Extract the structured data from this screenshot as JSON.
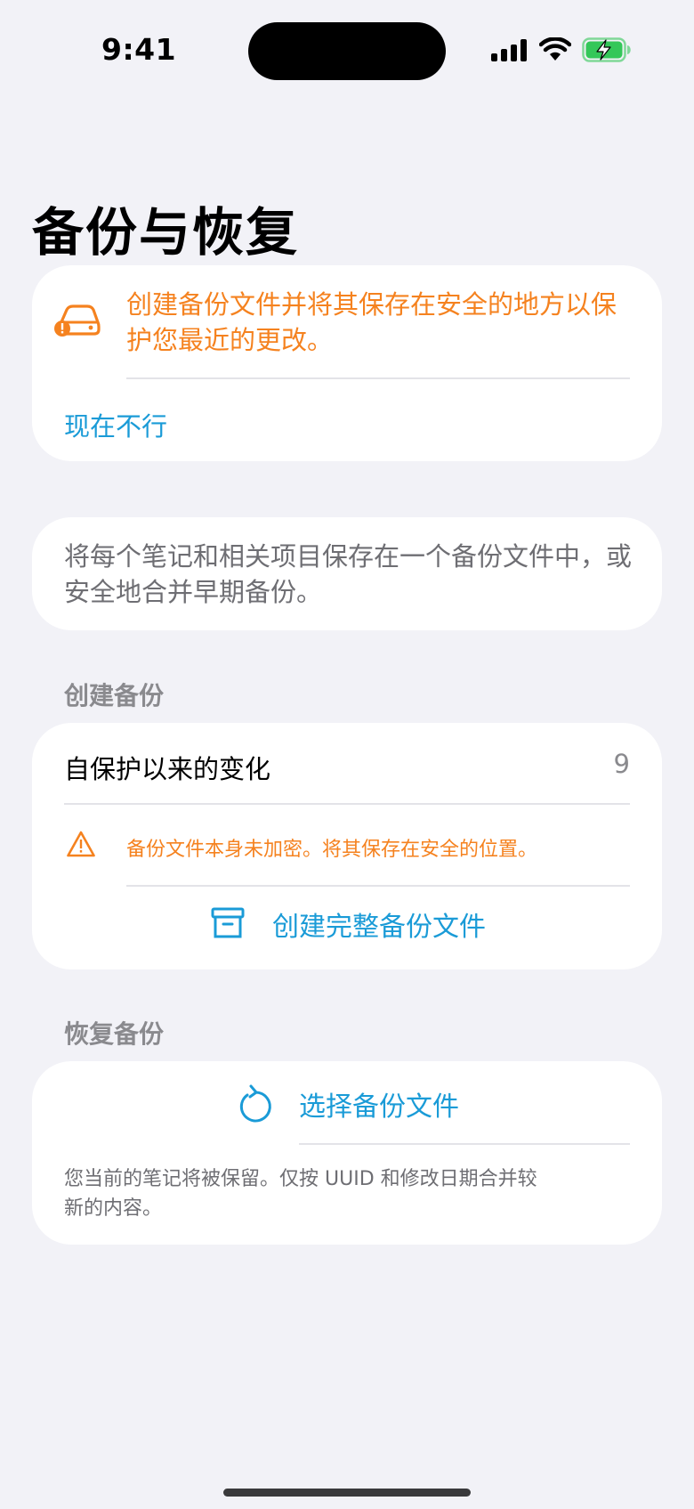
{
  "status_bar": {
    "time": "9:41",
    "icons": [
      "cellular-signal-icon",
      "wifi-icon",
      "battery-charging-icon"
    ],
    "battery_color": "#34C759"
  },
  "page": {
    "title": "备份与恢复"
  },
  "alert_card": {
    "icon": "drive-warning-icon",
    "message": "创建备份文件并将其保存在安全的地方以保护您最近的更改。",
    "dismiss_label": "现在不行"
  },
  "intro_card": {
    "text": "将每个笔记和相关项目保存在一个备份文件中，或安全地合并早期备份。"
  },
  "create_section": {
    "header": "创建备份",
    "changes_label": "自保护以来的变化",
    "changes_count": "9",
    "warning_icon": "warning-triangle-icon",
    "warning_text": "备份文件本身未加密。将其保存在安全的位置。",
    "action_icon": "archive-box-icon",
    "action_label": "创建完整备份文件"
  },
  "restore_section": {
    "header": "恢复备份",
    "action_icon": "restore-arrow-icon",
    "action_label": "选择备份文件",
    "note": "您当前的笔记将被保留。仅按 UUID 和修改日期合并较新的内容。"
  },
  "colors": {
    "accent": "#1A9BD7",
    "warning": "#F5821F",
    "background": "#F2F2F7",
    "card": "#FFFFFF",
    "secondary_text": "#8A8A8E"
  }
}
